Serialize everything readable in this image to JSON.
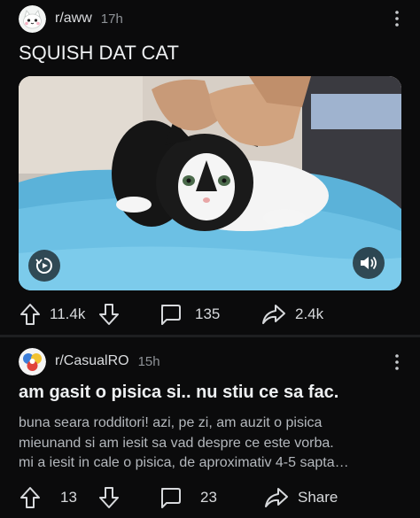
{
  "posts": [
    {
      "subreddit": "r/aww",
      "age": "17h",
      "title": "SQUISH DAT CAT",
      "upvotes": "11.4k",
      "comments": "135",
      "shares": "2.4k",
      "media_type": "video"
    },
    {
      "subreddit": "r/CasualRO",
      "age": "15h",
      "title": "am gasit o pisica si.. nu stiu ce sa fac.",
      "body_lines": [
        "buna seara rodditori! azi, pe zi, am auzit o pisica",
        "mieunand si am iesit sa vad despre ce este vorba.",
        "mi a iesit in cale o pisica, de aproximativ 4-5 sapta…"
      ],
      "upvotes": "13",
      "comments": "23",
      "shares": "Share"
    }
  ],
  "icons": {
    "upvote": "arrow-up-icon",
    "downvote": "arrow-down-icon",
    "comment": "comment-bubble-icon",
    "share": "share-arrow-icon",
    "more": "kebab-menu-icon",
    "video_badge": "video-badge-icon",
    "sound": "speaker-icon"
  },
  "colors": {
    "background": "#0b0b0c",
    "text": "#e6e8ea",
    "muted": "#8e9297",
    "divider": "#1e1f21"
  }
}
